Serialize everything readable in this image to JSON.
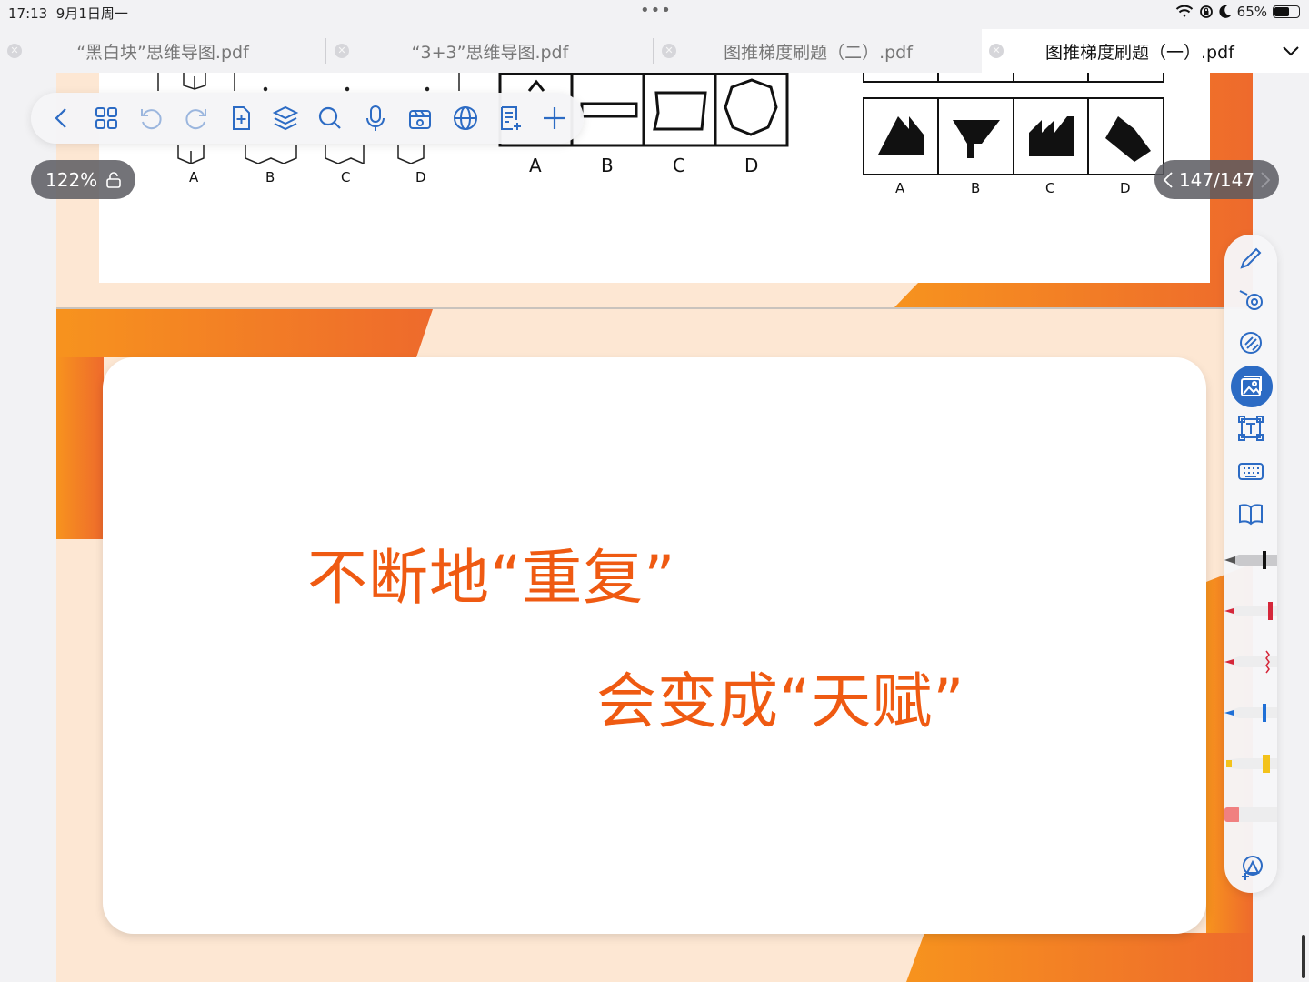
{
  "status_bar": {
    "time": "17:13",
    "date": "9月1日周一",
    "battery": "65%",
    "battery_level": 0.65
  },
  "tabs": [
    {
      "label": "“黑白块”思维导图.pdf",
      "active": false
    },
    {
      "label": "“3+3”思维导图.pdf",
      "active": false
    },
    {
      "label": "图推梯度刷题（二）.pdf",
      "active": false
    },
    {
      "label": "图推梯度刷题（一）.pdf",
      "active": true
    }
  ],
  "toolbar": {
    "icons": [
      "back-icon",
      "thumbnails-icon",
      "undo-icon",
      "redo-icon",
      "add-page-icon",
      "layers-icon",
      "search-icon",
      "microphone-icon",
      "media-icon",
      "translate-globe-icon",
      "notes-icon",
      "add-icon"
    ]
  },
  "viewer": {
    "zoom": "122%",
    "page_indicator": "147/147"
  },
  "document": {
    "options_left": [
      "A",
      "B",
      "C",
      "D"
    ],
    "options_middle": [
      "A",
      "B",
      "C",
      "D"
    ],
    "options_right": [
      "A",
      "B",
      "C",
      "D"
    ],
    "slogan_line1": "不断地“重复”",
    "slogan_line2": "会变成“天赋”"
  },
  "palette": {
    "tools": [
      "pencil-icon",
      "lasso-icon",
      "eraser-icon",
      "image-icon",
      "textbox-icon",
      "keyboard-icon",
      "book-icon",
      "fountain-pen-icon",
      "red-marker-icon",
      "red-wavy-pen-icon",
      "blue-pen-icon",
      "yellow-highlighter-icon",
      "eraser-stick-icon",
      "shapes-icon"
    ],
    "active_tool": "image-icon"
  },
  "colors": {
    "accent_orange": "#ef5a12",
    "page_background": "#fde7d3",
    "active_tool_blue": "#2c6bc4"
  }
}
